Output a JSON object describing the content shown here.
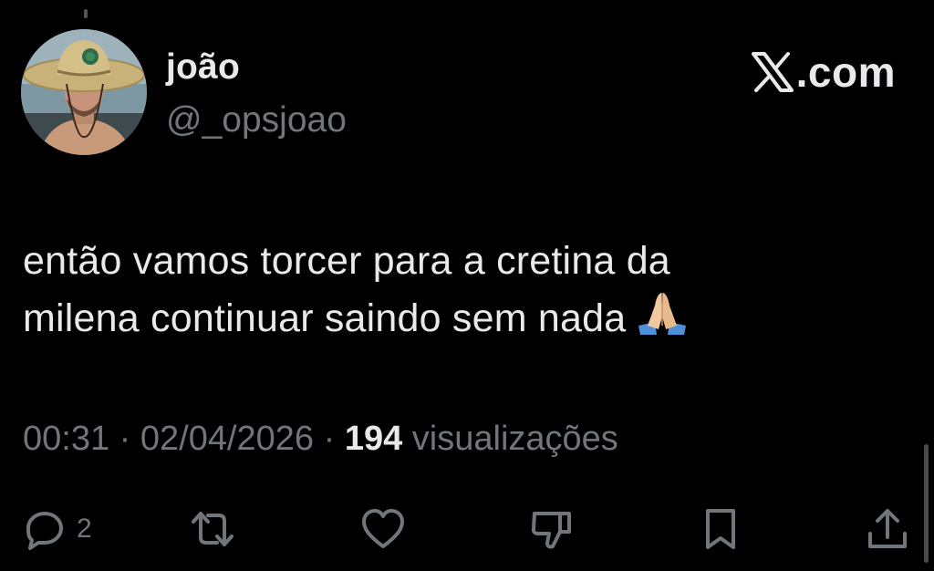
{
  "author": {
    "name": "joão",
    "handle": "@_opsjoao"
  },
  "brand": {
    "text": ".com",
    "icon": "x-logo-icon"
  },
  "tweet": {
    "line1": "então vamos torcer para a cretina da",
    "line2": "milena continuar saindo sem nada",
    "emoji": "folded-hands-icon"
  },
  "meta": {
    "time": "00:31",
    "separator": " · ",
    "date": "02/04/2026",
    "views_count": "194",
    "views_label": " visualizações"
  },
  "actions": {
    "reply_icon": "reply-icon",
    "reply_count": "2",
    "retweet_icon": "retweet-icon",
    "like_icon": "heart-icon",
    "dislike_icon": "thumbs-down-icon",
    "bookmark_icon": "bookmark-icon",
    "share_icon": "share-icon"
  },
  "colors": {
    "background": "#000000",
    "text": "#e7e9ea",
    "muted": "#71767b"
  }
}
